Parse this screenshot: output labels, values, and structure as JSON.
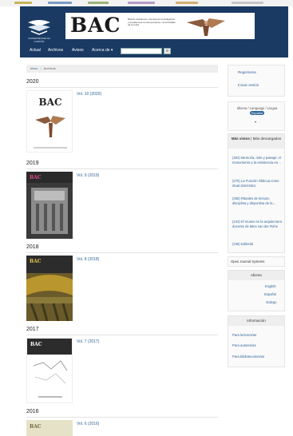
{
  "banner": {
    "title": "BAC",
    "description": "Boletín Académico. Revista de Investigación y Arquitectura Contemporánea. Universidade da Coruña",
    "university": "Universidade da Coruña"
  },
  "nav": {
    "items": [
      "Actual",
      "Archivos",
      "Avisos",
      "Acerca de"
    ],
    "search_placeholder": "",
    "search_button": "Q"
  },
  "breadcrumb": [
    "Inicio",
    "Archivos"
  ],
  "issues": [
    {
      "year": "2020",
      "label": "Vol. 10 (2020)"
    },
    {
      "year": "2019",
      "label": "Vol. 9 (2019)"
    },
    {
      "year": "2018",
      "label": "Vol. 8 (2018)"
    },
    {
      "year": "2017",
      "label": "Vol. 7 (2017)"
    },
    {
      "year": "2016",
      "label": "Vol. 6 (2016)"
    }
  ],
  "sidebar": {
    "register": "Registrarse",
    "login": "Iniciar sesión",
    "language_label": "Idioma / Language / Lingua",
    "language_selected": "Español",
    "tabs": [
      "Más vistos",
      "Más descargados"
    ],
    "most_viewed": [
      "(304) Memoria, mito y paisaje: el monumento a la resistencia en…",
      "(275) La Función Oblicua como ritual doméstico",
      "(265) Rituales de lectura: disciplina y disyuntiva de la…",
      "(244) El museo en la arquitectura docente de Mies van der Rohe",
      "(236) Editorial"
    ],
    "ojs": "Open Journal Systems",
    "idioma_title": "Idioma",
    "languages": [
      "English",
      "Español",
      "Galego"
    ],
    "info_title": "Información",
    "info_links": [
      "Para lectores/as",
      "Para autores/as",
      "Para bibliotecarios/as"
    ]
  },
  "colors": {
    "header_bg": "#1a3a63",
    "link": "#336699"
  }
}
